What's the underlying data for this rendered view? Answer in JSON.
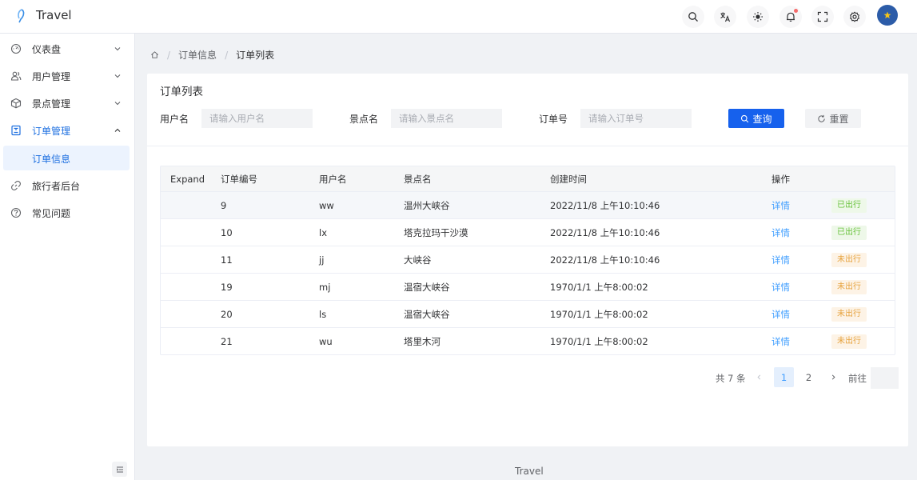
{
  "app": {
    "title": "Travel"
  },
  "sidebar": {
    "items": [
      {
        "label": "仪表盘"
      },
      {
        "label": "用户管理"
      },
      {
        "label": "景点管理"
      },
      {
        "label": "订单管理"
      },
      {
        "label": "旅行者后台"
      },
      {
        "label": "常见问题"
      }
    ],
    "sub_items": [
      {
        "label": "订单信息"
      }
    ]
  },
  "breadcrumb": {
    "level1": "订单信息",
    "level2": "订单列表",
    "separator": "/"
  },
  "card": {
    "title": "订单列表"
  },
  "filters": {
    "username_label": "用户名",
    "username_placeholder": "请输入用户名",
    "spot_label": "景点名",
    "spot_placeholder": "请输入景点名",
    "order_label": "订单号",
    "order_placeholder": "请输入订单号",
    "query_label": "查询",
    "reset_label": "重置"
  },
  "table": {
    "headers": {
      "expand": "Expand",
      "id": "订单编号",
      "user": "用户名",
      "spot": "景点名",
      "time": "创建时间",
      "action": "操作"
    },
    "rows": [
      {
        "id": "9",
        "user": "ww",
        "spot": "温州大峡谷",
        "time": "2022/11/8 上午10:10:46",
        "action": "详情",
        "status": "已出行"
      },
      {
        "id": "10",
        "user": "lx",
        "spot": "塔克拉玛干沙漠",
        "time": "2022/11/8 上午10:10:46",
        "action": "详情",
        "status": "已出行"
      },
      {
        "id": "11",
        "user": "jj",
        "spot": "大峡谷",
        "time": "2022/11/8 上午10:10:46",
        "action": "详情",
        "status": "未出行"
      },
      {
        "id": "19",
        "user": "mj",
        "spot": "温宿大峡谷",
        "time": "1970/1/1 上午8:00:02",
        "action": "详情",
        "status": "未出行"
      },
      {
        "id": "20",
        "user": "ls",
        "spot": "温宿大峡谷",
        "time": "1970/1/1 上午8:00:02",
        "action": "详情",
        "status": "未出行"
      },
      {
        "id": "21",
        "user": "wu",
        "spot": "塔里木河",
        "time": "1970/1/1 上午8:00:02",
        "action": "详情",
        "status": "未出行"
      }
    ]
  },
  "pagination": {
    "total_text": "共 7 条",
    "page1": "1",
    "page2": "2",
    "goto_label": "前往",
    "current": 1
  },
  "footer": {
    "text": "Travel"
  },
  "colors": {
    "primary": "#1661ed",
    "link": "#409eff",
    "done": "#67c23a",
    "pending": "#e6a23c",
    "badge": "#f56c6c"
  }
}
